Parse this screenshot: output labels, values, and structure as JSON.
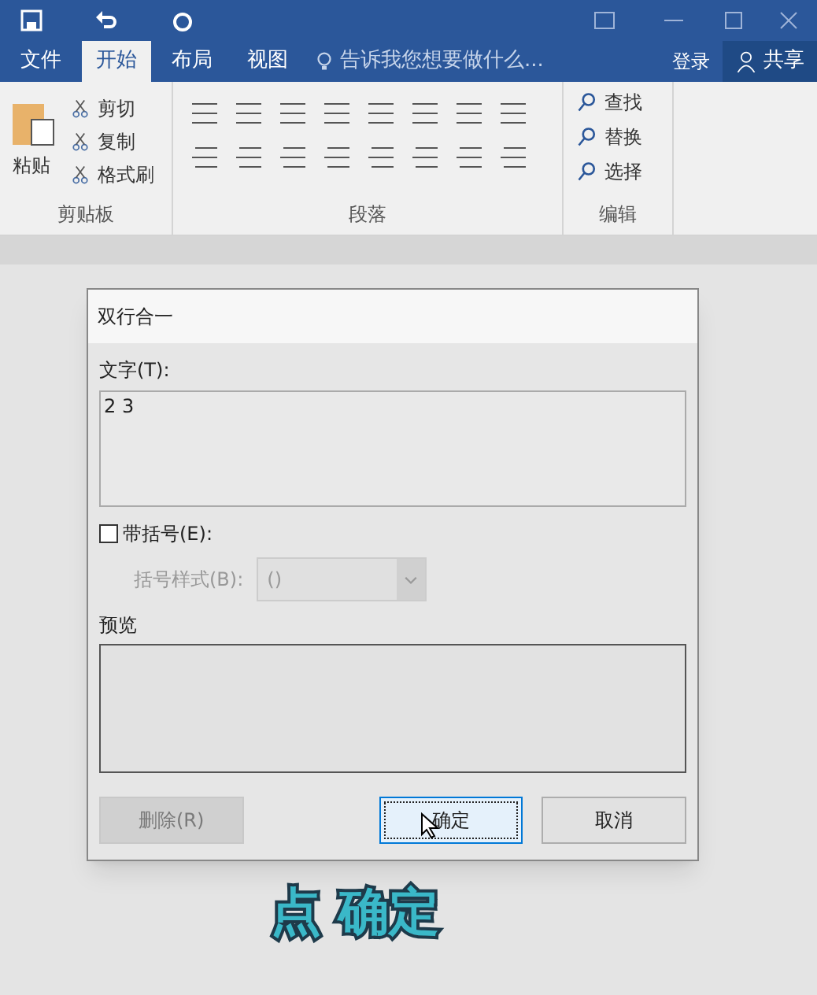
{
  "ribbon_tabs": [
    {
      "label": "文件",
      "selected": false
    },
    {
      "label": "开始",
      "selected": true
    },
    {
      "label": "布局",
      "selected": false
    },
    {
      "label": "视图",
      "selected": false
    }
  ],
  "tell_me": {
    "placeholder": "告诉我您想要做什么..."
  },
  "sign_in": "登录",
  "share": "共享",
  "clipboard": {
    "paste": "粘贴",
    "items": [
      "剪切",
      "复制",
      "格式刷"
    ],
    "label": "剪贴板"
  },
  "paragraph": {
    "label": "段落"
  },
  "editing": {
    "items": [
      "查找",
      "替换",
      "选择"
    ],
    "label": "编辑"
  },
  "dialog": {
    "title": "双行合一",
    "text_label": "文字(T):",
    "text_value": "2 3",
    "bracket_checkbox": {
      "label": "带括号(E):",
      "checked": false
    },
    "bracket_style": {
      "label": "括号样式(B):",
      "value": "()",
      "disabled": true
    },
    "preview_label": "预览",
    "buttons": [
      {
        "label": "删除(R)",
        "disabled": true,
        "focused": false
      },
      {
        "label": "确定",
        "disabled": false,
        "focused": true
      },
      {
        "label": "取消",
        "disabled": false,
        "focused": false
      }
    ]
  },
  "caption": "点 确定"
}
